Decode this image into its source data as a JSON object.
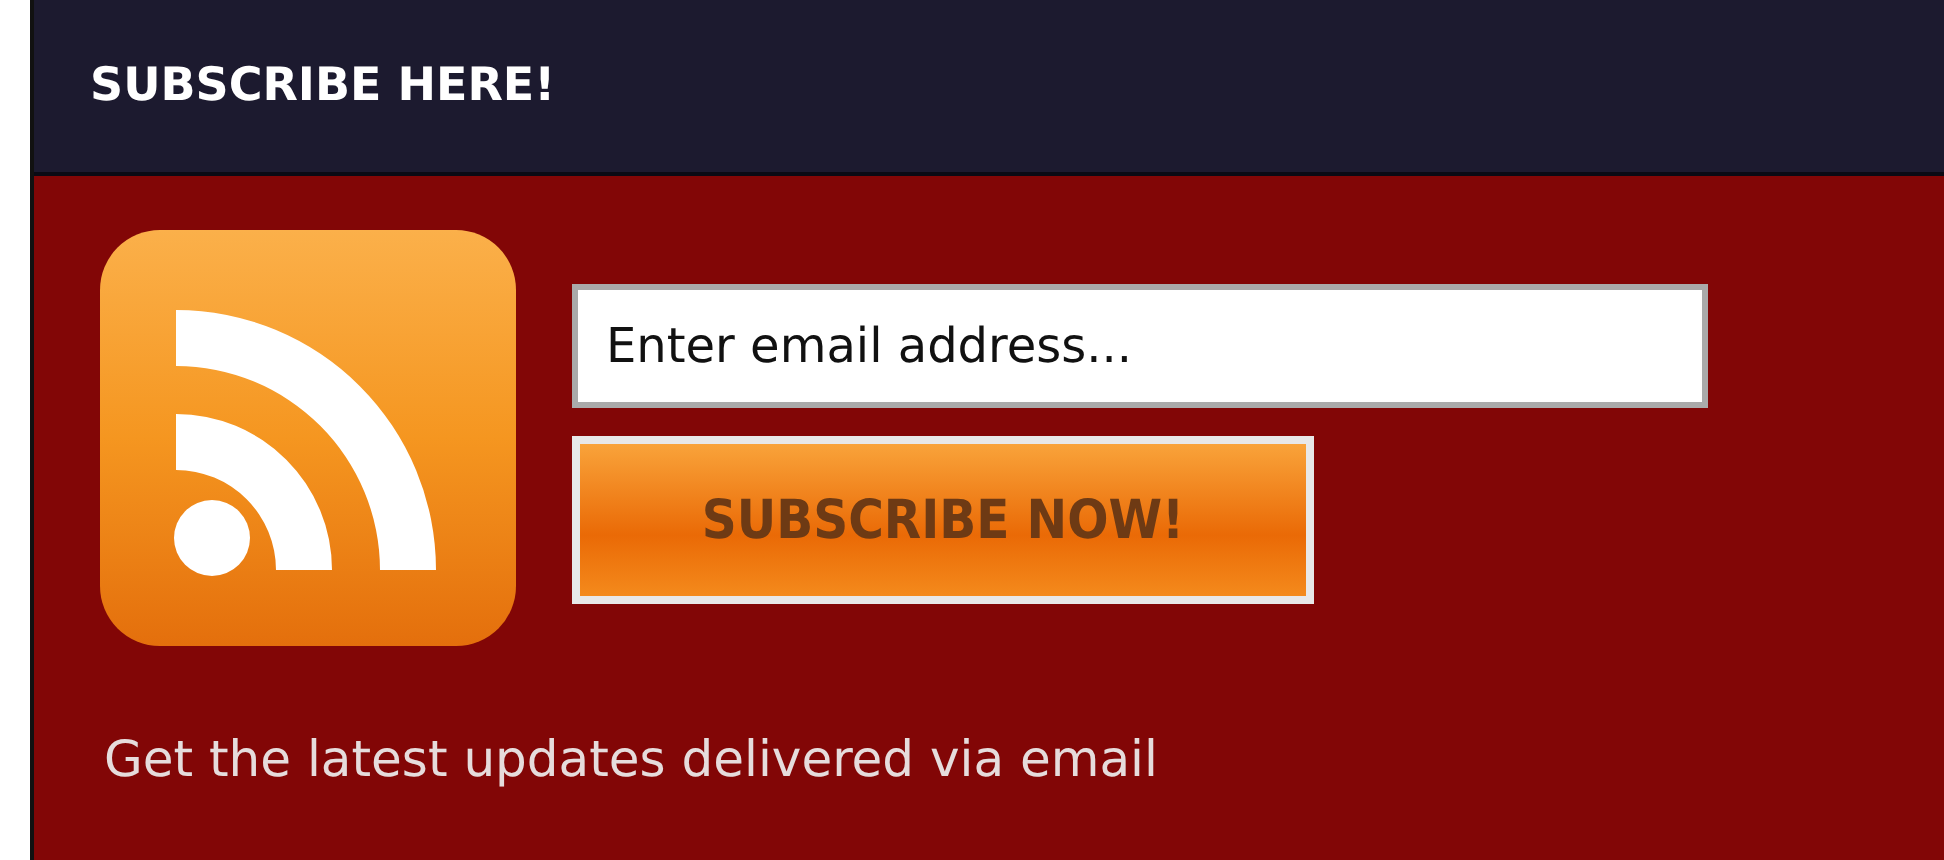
{
  "header": {
    "title": "SUBSCRIBE HERE!"
  },
  "form": {
    "email": {
      "placeholder": "Enter email address..."
    },
    "button": "SUBSCRIBE NOW!"
  },
  "footer_text": "Get the latest updates delivered via email"
}
